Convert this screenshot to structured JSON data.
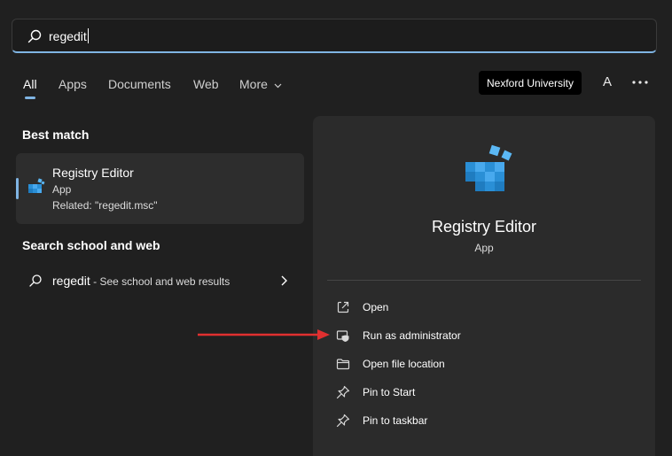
{
  "search": {
    "query": "regedit"
  },
  "tabs": [
    {
      "label": "All",
      "active": true
    },
    {
      "label": "Apps"
    },
    {
      "label": "Documents"
    },
    {
      "label": "Web"
    },
    {
      "label": "More"
    }
  ],
  "header": {
    "organization": "Nexford University",
    "avatar_initial": "A"
  },
  "best_match": {
    "heading": "Best match",
    "name": "Registry Editor",
    "type": "App",
    "related": "Related: \"regedit.msc\""
  },
  "web_search": {
    "heading": "Search school and web",
    "query": "regedit",
    "suffix": " - See school and web results"
  },
  "detail": {
    "name": "Registry Editor",
    "type": "App",
    "actions": [
      {
        "label": "Open",
        "icon": "open-icon"
      },
      {
        "label": "Run as administrator",
        "icon": "shield-icon"
      },
      {
        "label": "Open file location",
        "icon": "folder-icon"
      },
      {
        "label": "Pin to Start",
        "icon": "pin-icon"
      },
      {
        "label": "Pin to taskbar",
        "icon": "pin-icon"
      }
    ]
  },
  "colors": {
    "accent": "#7fb4e3",
    "background": "#202020",
    "panel": "#2b2b2b",
    "annotation_arrow": "#e03030"
  }
}
